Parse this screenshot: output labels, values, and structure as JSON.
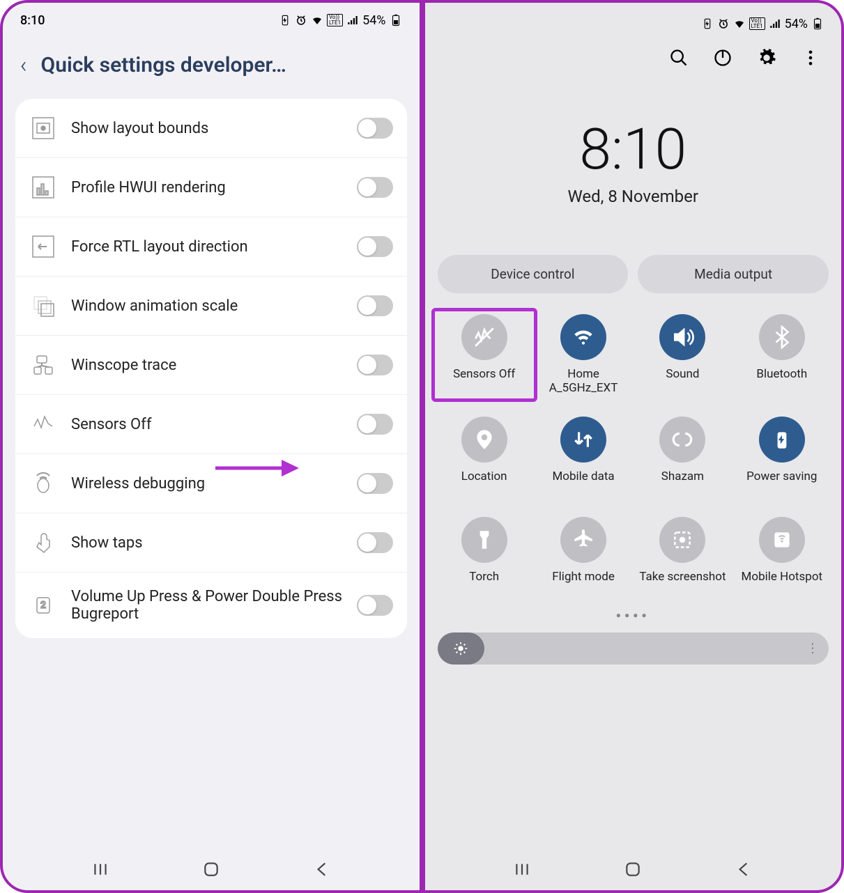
{
  "left": {
    "time": "8:10",
    "battery": "54%",
    "title": "Quick settings developer…",
    "rows": [
      "Show layout bounds",
      "Profile HWUI rendering",
      "Force RTL layout direction",
      "Window animation scale",
      "Winscope trace",
      "Sensors Off",
      "Wireless debugging",
      "Show taps",
      "Volume Up Press & Power Double Press Bugreport"
    ]
  },
  "right": {
    "battery": "54%",
    "time": "8:10",
    "date": "Wed, 8 November",
    "pills": [
      "Device control",
      "Media output"
    ],
    "tiles": [
      {
        "label": "Sensors Off",
        "on": false,
        "icon": "sensors",
        "highlight": true
      },
      {
        "label": "Home A_5GHz_EXT",
        "on": true,
        "icon": "wifi"
      },
      {
        "label": "Sound",
        "on": true,
        "icon": "sound"
      },
      {
        "label": "Bluetooth",
        "on": false,
        "icon": "bluetooth"
      },
      {
        "label": "Location",
        "on": false,
        "icon": "location"
      },
      {
        "label": "Mobile data",
        "on": true,
        "icon": "data"
      },
      {
        "label": "Shazam",
        "on": false,
        "icon": "shazam"
      },
      {
        "label": "Power saving",
        "on": true,
        "icon": "power"
      },
      {
        "label": "Torch",
        "on": false,
        "icon": "torch"
      },
      {
        "label": "Flight mode",
        "on": false,
        "icon": "flight"
      },
      {
        "label": "Take screenshot",
        "on": false,
        "icon": "screenshot"
      },
      {
        "label": "Mobile Hotspot",
        "on": false,
        "icon": "hotspot"
      }
    ]
  }
}
